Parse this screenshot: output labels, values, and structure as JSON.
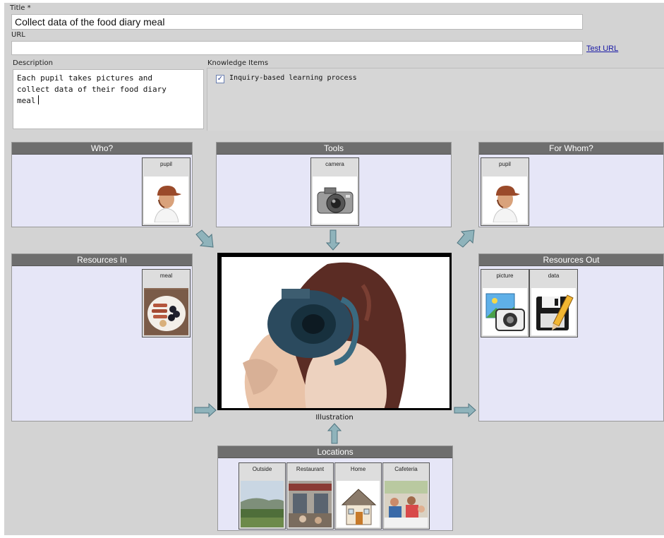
{
  "form": {
    "title_label": "Title *",
    "title_value": "Collect data of the food diary meal",
    "url_label": "URL",
    "url_value": "",
    "test_url_link": "Test URL",
    "description_label": "Description",
    "description_value": "Each pupil takes pictures and\ncollect data of their food diary\nmeal",
    "knowledge_label": "Knowledge Items",
    "knowledge_items": [
      {
        "label": "Inquiry-based learning process",
        "checked": true
      }
    ]
  },
  "panels": {
    "who": {
      "title": "Who?",
      "tiles": [
        {
          "label": "pupil",
          "icon": "pupil-icon"
        }
      ]
    },
    "tools": {
      "title": "Tools",
      "tiles": [
        {
          "label": "camera",
          "icon": "camera-icon"
        }
      ]
    },
    "for_whom": {
      "title": "For Whom?",
      "tiles": [
        {
          "label": "pupil",
          "icon": "pupil-icon"
        }
      ]
    },
    "resources_in": {
      "title": "Resources In",
      "tiles": [
        {
          "label": "meal",
          "icon": "meal-icon"
        }
      ]
    },
    "resources_out": {
      "title": "Resources Out",
      "tiles": [
        {
          "label": "picture",
          "icon": "picture-icon"
        },
        {
          "label": "data",
          "icon": "data-icon"
        }
      ]
    },
    "locations": {
      "title": "Locations",
      "tiles": [
        {
          "label": "Outside",
          "icon": "outside-icon"
        },
        {
          "label": "Restaurant",
          "icon": "restaurant-icon"
        },
        {
          "label": "Home",
          "icon": "home-icon"
        },
        {
          "label": "Cafeteria",
          "icon": "cafeteria-icon"
        }
      ]
    }
  },
  "illustration": {
    "label": "Illustration"
  },
  "colors": {
    "panel_bg": "#e6e6f7",
    "panel_header": "#6e6e6e",
    "page_bg": "#d3d3d3",
    "link": "#1a1aa6",
    "arrow": "#8fb3bb"
  }
}
